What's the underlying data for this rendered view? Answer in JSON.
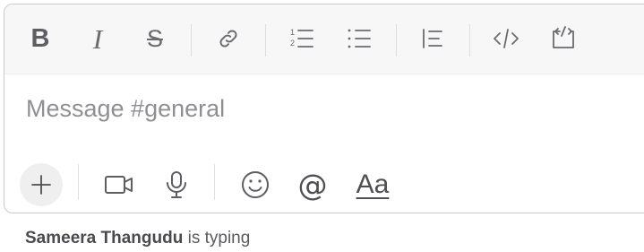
{
  "toolbar": {
    "bold": {
      "label": "B",
      "icon": "bold-icon"
    },
    "italic": {
      "label": "I",
      "icon": "italic-icon"
    },
    "strike": {
      "label": "S",
      "icon": "strikethrough-icon"
    },
    "link": {
      "icon": "link-icon"
    },
    "ordered_list": {
      "icon": "ordered-list-icon"
    },
    "bullet_list": {
      "icon": "bullet-list-icon"
    },
    "blockquote": {
      "icon": "blockquote-icon"
    },
    "code": {
      "icon": "code-icon"
    },
    "code_block": {
      "icon": "code-block-icon"
    }
  },
  "composer": {
    "placeholder": "Message #general",
    "value": ""
  },
  "actions": {
    "attach": {
      "icon": "plus-icon"
    },
    "video": {
      "icon": "video-camera-icon"
    },
    "audio": {
      "icon": "microphone-icon"
    },
    "emoji": {
      "icon": "emoji-icon"
    },
    "mention": {
      "label": "@",
      "icon": "at-sign-icon"
    },
    "format": {
      "label": "Aa"
    }
  },
  "typing_indicator": {
    "name": "Sameera Thangudu",
    "text": " is typing"
  },
  "colors": {
    "toolbar_bg": "#f7f7f8",
    "icon": "#6b6b6f",
    "border": "#c9c9cc",
    "placeholder": "#8f8f93"
  }
}
